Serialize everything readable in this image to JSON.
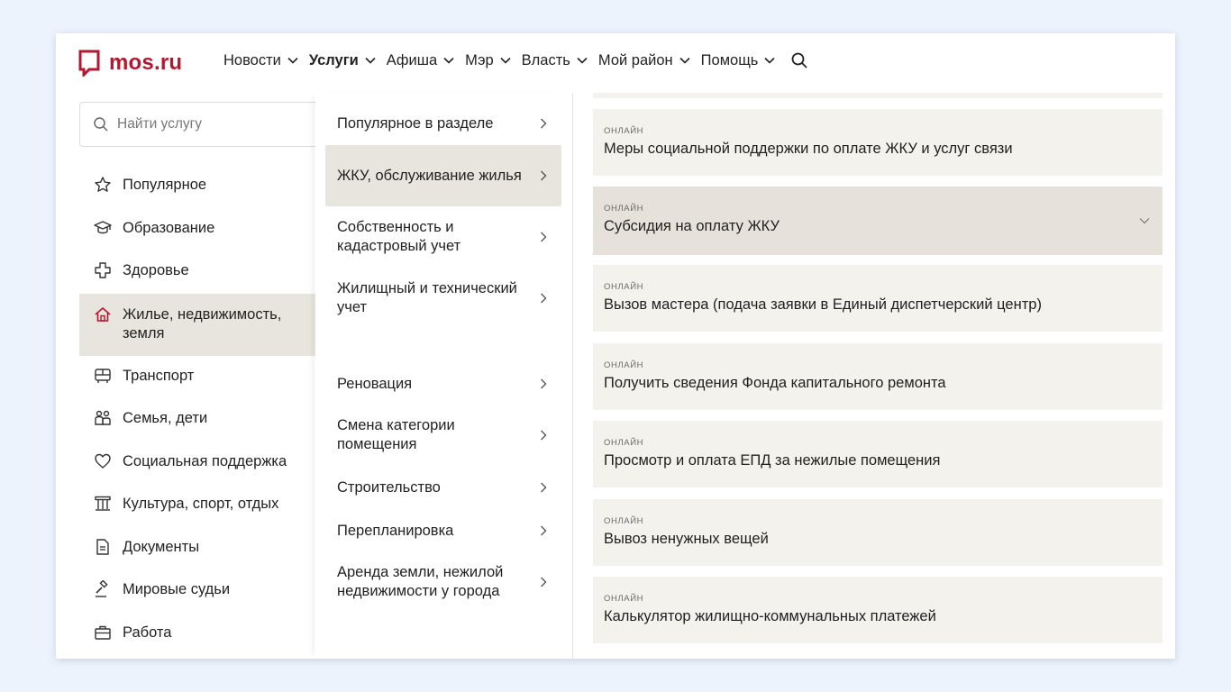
{
  "brand": {
    "name": "mos.ru",
    "color": "#b5172e"
  },
  "nav": {
    "items": [
      {
        "label": "Новости"
      },
      {
        "label": "Услуги"
      },
      {
        "label": "Афиша"
      },
      {
        "label": "Мэр"
      },
      {
        "label": "Власть"
      },
      {
        "label": "Мой район"
      },
      {
        "label": "Помощь"
      }
    ],
    "active": "Услуги"
  },
  "search": {
    "placeholder": "Найти услугу"
  },
  "categories": [
    {
      "label": "Популярное",
      "icon": "star-icon"
    },
    {
      "label": "Образование",
      "icon": "graduation-cap-icon"
    },
    {
      "label": "Здоровье",
      "icon": "medical-cross-icon"
    },
    {
      "label": "Жилье, недвижимость, земля",
      "icon": "house-icon",
      "active": true
    },
    {
      "label": "Транспорт",
      "icon": "bus-icon"
    },
    {
      "label": "Семья, дети",
      "icon": "family-icon"
    },
    {
      "label": "Социальная поддержка",
      "icon": "heart-icon"
    },
    {
      "label": "Культура, спорт, отдых",
      "icon": "columns-icon"
    },
    {
      "label": "Документы",
      "icon": "document-icon"
    },
    {
      "label": "Мировые судьи",
      "icon": "gavel-icon"
    },
    {
      "label": "Работа",
      "icon": "briefcase-icon"
    }
  ],
  "subcategories": [
    {
      "label": "Популярное в разделе"
    },
    {
      "label": "ЖКУ, обслуживание жилья",
      "active": true
    },
    {
      "label": "Собственность и кадастровый учет"
    },
    {
      "label": "Жилищный и технический учет"
    },
    {
      "label": "Реновация"
    },
    {
      "label": "Смена категории помещения"
    },
    {
      "label": "Строительство"
    },
    {
      "label": "Перепланировка"
    },
    {
      "label": "Аренда земли, нежилой недвижимости у города"
    }
  ],
  "services": [
    {
      "tag": "онлайн",
      "title": "Меры социальной поддержки по оплате ЖКУ и услуг связи"
    },
    {
      "tag": "онлайн",
      "title": "Субсидия на оплату ЖКУ",
      "active": true
    },
    {
      "tag": "онлайн",
      "title": "Вызов мастера (подача заявки в Единый диспетчерский центр)"
    },
    {
      "tag": "онлайн",
      "title": "Получить сведения Фонда капитального ремонта"
    },
    {
      "tag": "онлайн",
      "title": "Просмотр и оплата ЕПД за нежилые помещения"
    },
    {
      "tag": "онлайн",
      "title": "Вывоз ненужных вещей"
    },
    {
      "tag": "онлайн",
      "title": "Калькулятор жилищно-коммунальных платежей"
    }
  ]
}
